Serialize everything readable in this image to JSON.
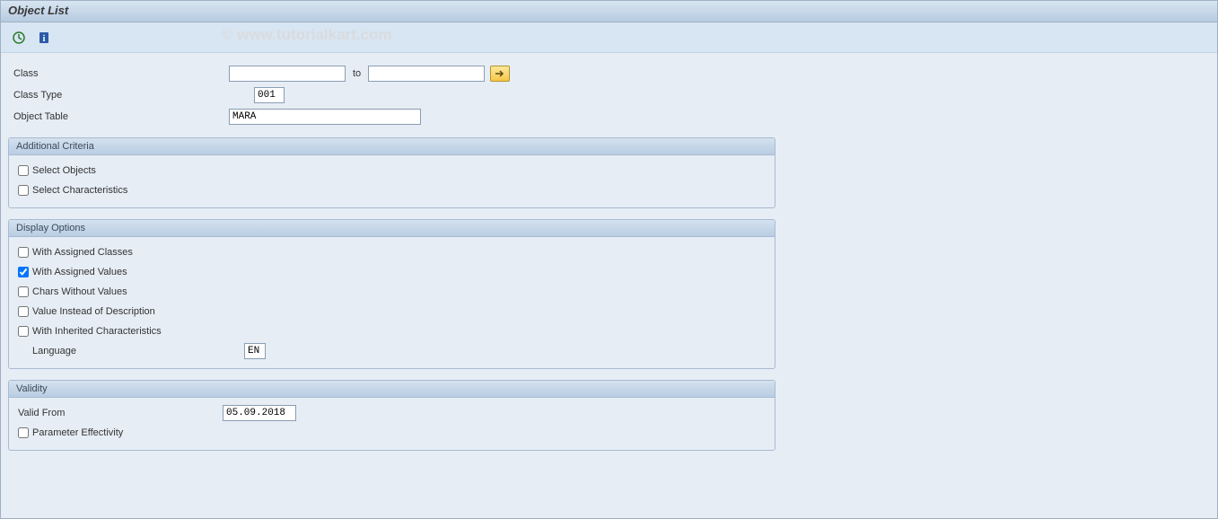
{
  "window": {
    "title": "Object List"
  },
  "watermark": "© www.tutorialkart.com",
  "fields": {
    "class_label": "Class",
    "class_from": "",
    "class_to_sep": "to",
    "class_to": "",
    "class_type_label": "Class Type",
    "class_type_value": "001",
    "object_table_label": "Object Table",
    "object_table_value": "MARA"
  },
  "additional_criteria": {
    "title": "Additional Criteria",
    "select_objects_label": "Select Objects",
    "select_objects_checked": false,
    "select_characteristics_label": "Select Characteristics",
    "select_characteristics_checked": false
  },
  "display_options": {
    "title": "Display Options",
    "with_assigned_classes_label": "With Assigned Classes",
    "with_assigned_classes_checked": false,
    "with_assigned_values_label": "With Assigned Values",
    "with_assigned_values_checked": true,
    "chars_without_values_label": "Chars Without Values",
    "chars_without_values_checked": false,
    "value_instead_desc_label": "Value Instead of Description",
    "value_instead_desc_checked": false,
    "with_inherited_chars_label": "With Inherited Characteristics",
    "with_inherited_chars_checked": false,
    "language_label": "Language",
    "language_value": "EN"
  },
  "validity": {
    "title": "Validity",
    "valid_from_label": "Valid From",
    "valid_from_value": "05.09.2018",
    "parameter_effectivity_label": "Parameter Effectivity",
    "parameter_effectivity_checked": false
  },
  "colors": {
    "accent_yellow": "#f7c64b",
    "panel_border": "#a9bbd1",
    "bg": "#e6edf5"
  }
}
